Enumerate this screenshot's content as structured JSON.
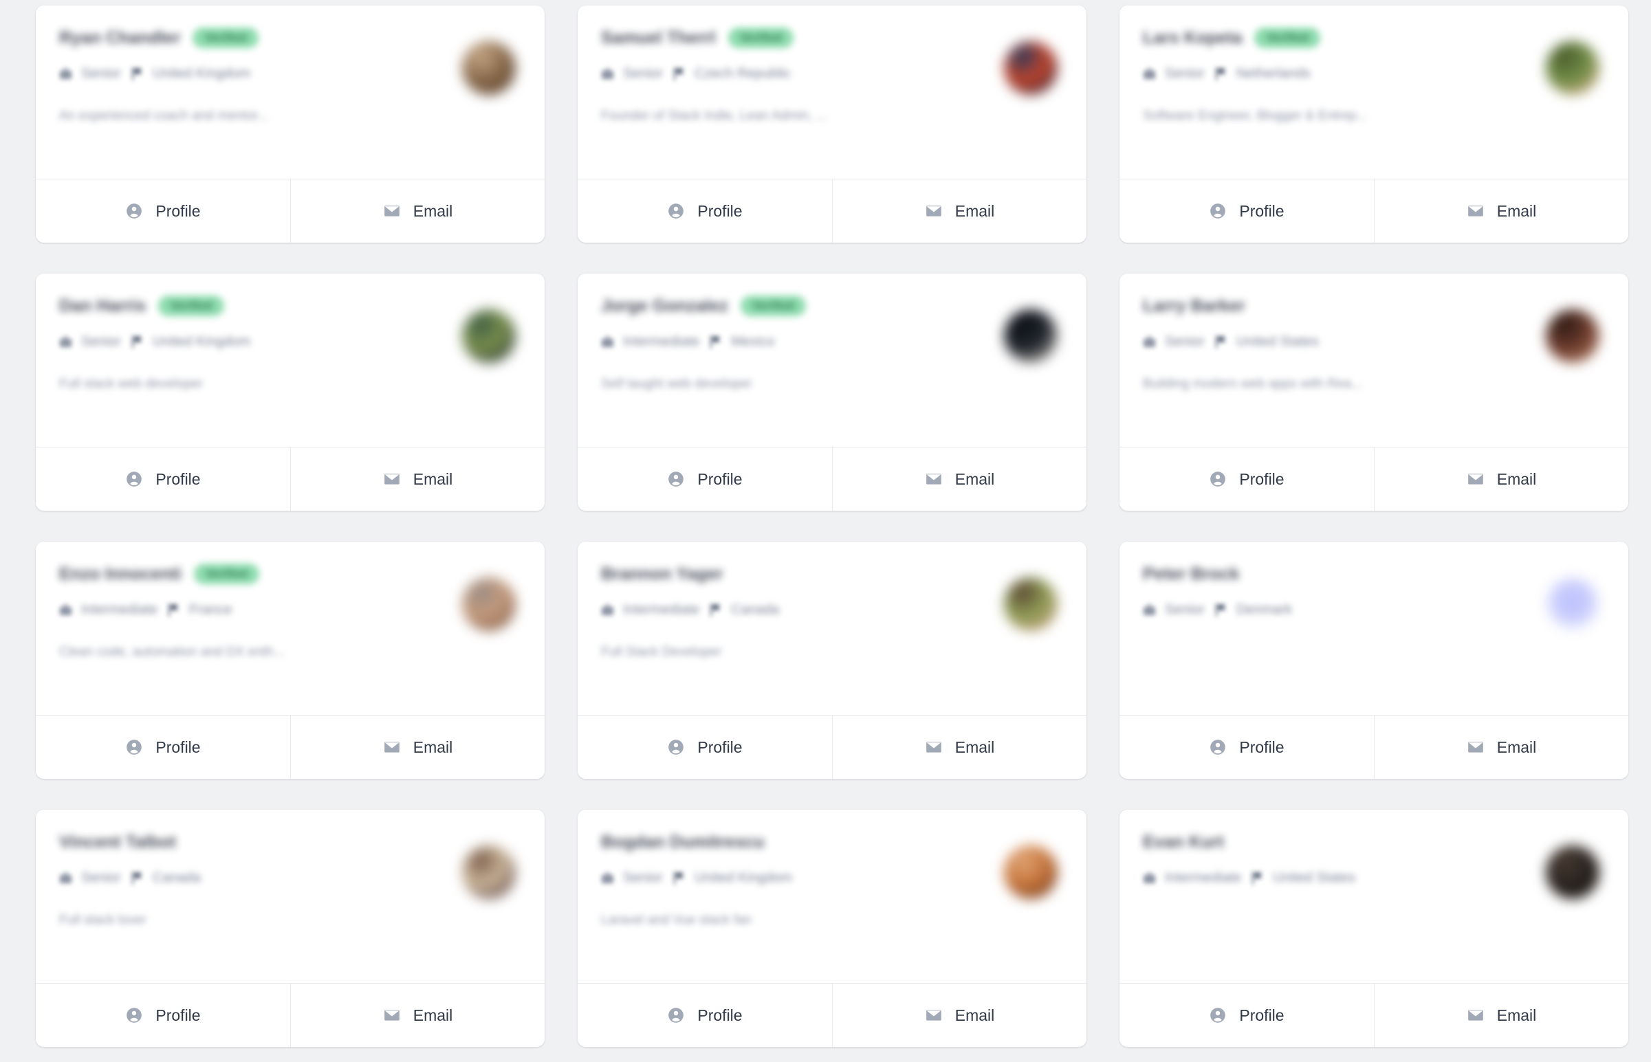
{
  "page": {
    "background_color": "#f0f1f3",
    "card_background": "#ffffff",
    "badge_color": "#8fdcb0",
    "badge_text_color": "#2c7a51",
    "icon_color": "#a2a9b6",
    "button_text_color": "#323a49"
  },
  "actions": {
    "profile_label": "Profile",
    "email_label": "Email",
    "profile_icon": "account-circle-icon",
    "email_icon": "envelope-icon"
  },
  "cards": [
    {
      "name": "Ryan Chandler",
      "badge": "Verified",
      "level": "Senior",
      "country": "United Kingdom",
      "bio": "An experienced coach and mentor...",
      "avatar_type": "photo",
      "avatar_colors": [
        "#8a6a4b",
        "#4a3425",
        "#c7a887"
      ]
    },
    {
      "name": "Samuel Therrl",
      "badge": "Verified",
      "level": "Senior",
      "country": "Czech Republic",
      "bio": "Founder of Stack Indie, Lean Admin, ...",
      "avatar_type": "photo",
      "avatar_colors": [
        "#c0442c",
        "#1b2540",
        "#2b3a5c"
      ]
    },
    {
      "name": "Lars Kopeta",
      "badge": "Verified",
      "level": "Senior",
      "country": "Netherlands",
      "bio": "Software Engineer, Blogger & Entrep...",
      "avatar_type": "photo",
      "avatar_colors": [
        "#6f8c46",
        "#e3b28c",
        "#4a5b2c"
      ]
    },
    {
      "name": "Dan Harris",
      "badge": "Verified",
      "level": "Senior",
      "country": "United Kingdom",
      "bio": "Full stack web developer",
      "avatar_type": "photo",
      "avatar_colors": [
        "#7a8f4e",
        "#13202e",
        "#3f5d43"
      ]
    },
    {
      "name": "Jorge Gonzalez",
      "badge": "Verified",
      "level": "Intermediate",
      "country": "Mexico",
      "bio": "Self taught web developer",
      "avatar_type": "photo",
      "avatar_colors": [
        "#20242c",
        "#d9d2c6",
        "#0d1016"
      ]
    },
    {
      "name": "Larry Barker",
      "badge": "",
      "level": "Senior",
      "country": "United States",
      "bio": "Building modern web apps with Rea...",
      "avatar_type": "photo",
      "avatar_colors": [
        "#6a3a2c",
        "#c58a6b",
        "#2c1a14"
      ]
    },
    {
      "name": "Enzo Innocenti",
      "badge": "Verified",
      "level": "Intermediate",
      "country": "France",
      "bio": "Clean code, automation and DX enth...",
      "avatar_type": "photo",
      "avatar_colors": [
        "#c49a7c",
        "#6b4836",
        "#9a8c84"
      ]
    },
    {
      "name": "Brannon Yager",
      "badge": "",
      "level": "Intermediate",
      "country": "Canada",
      "bio": "Full Stack Developer",
      "avatar_type": "photo",
      "avatar_colors": [
        "#8d9d55",
        "#d79c88",
        "#5c4634"
      ]
    },
    {
      "name": "Peter Brock",
      "badge": "",
      "level": "Senior",
      "country": "Denmark",
      "bio": "",
      "avatar_type": "placeholder",
      "avatar_colors": [
        "#b9beff",
        "#ccd0fb",
        "#ffffff"
      ]
    },
    {
      "name": "Vincent Talbot",
      "badge": "",
      "level": "Senior",
      "country": "Canada",
      "bio": "Full stack lover",
      "avatar_type": "photo",
      "avatar_colors": [
        "#cbb69a",
        "#3a1f2a",
        "#7a5c4a"
      ]
    },
    {
      "name": "Bogdan Dumitrescu",
      "badge": "",
      "level": "Senior",
      "country": "United Kingdom",
      "bio": "Laravel and Vue stack fan",
      "avatar_type": "photo",
      "avatar_colors": [
        "#c8763c",
        "#5a2d18",
        "#e0a678"
      ]
    },
    {
      "name": "Evan Kurt",
      "badge": "",
      "level": "Intermediate",
      "country": "United States",
      "bio": "",
      "avatar_type": "photo",
      "avatar_colors": [
        "#2a2420",
        "#1b1614",
        "#4a3c33"
      ]
    }
  ]
}
